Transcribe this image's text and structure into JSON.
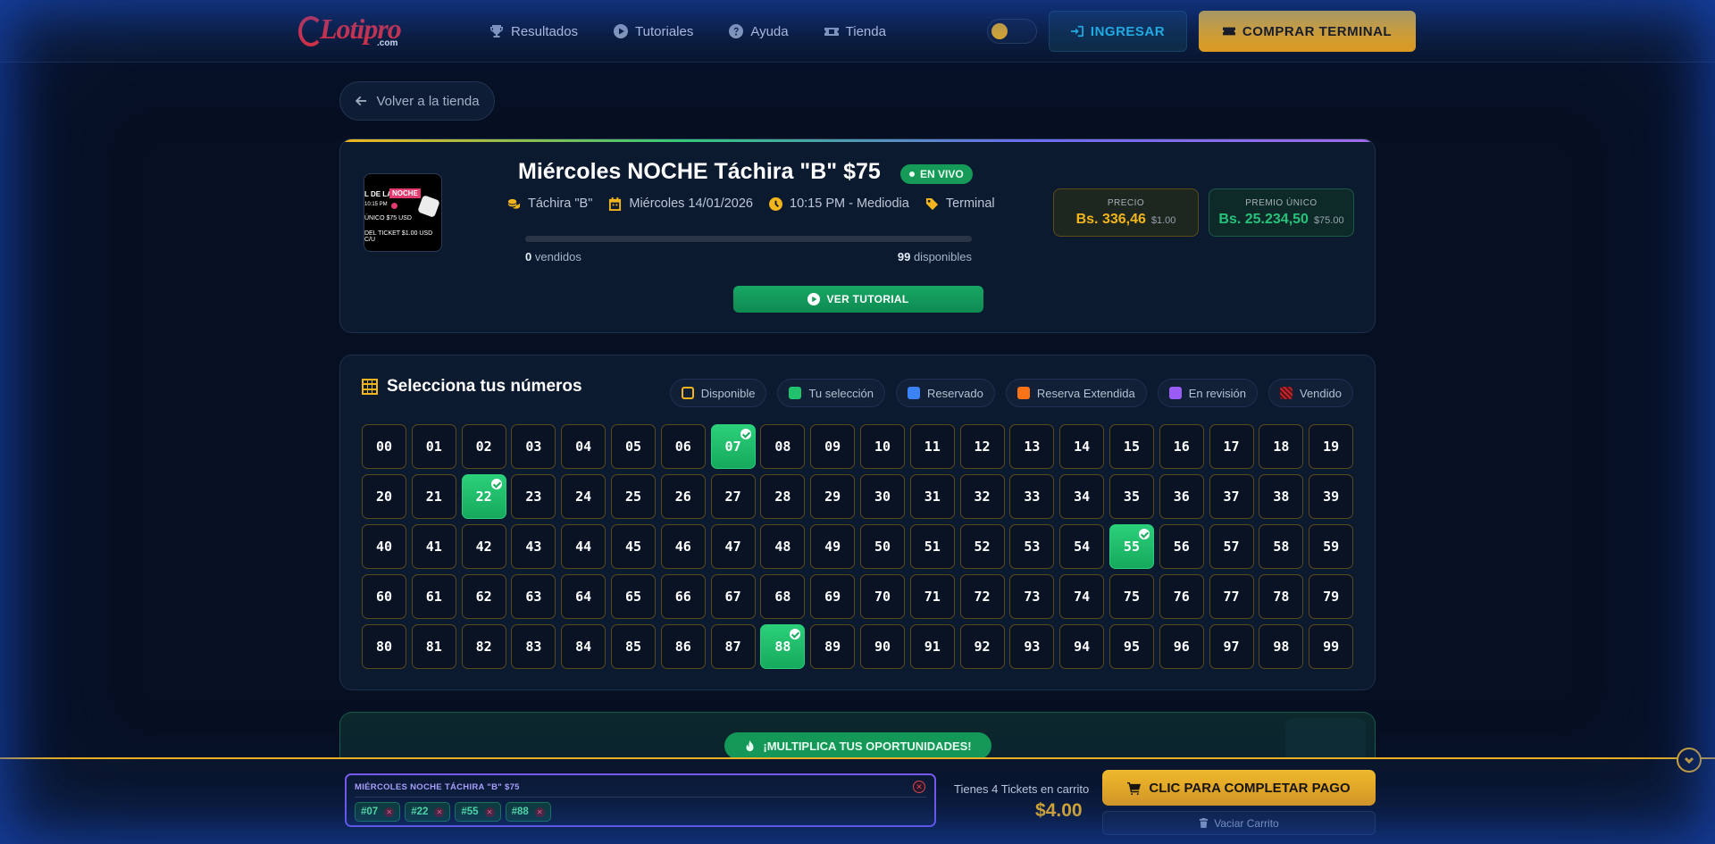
{
  "header": {
    "logo_text": "Lotipro",
    "logo_sub": ".com",
    "nav": [
      {
        "label": "Resultados",
        "icon": "trophy-icon"
      },
      {
        "label": "Tutoriales",
        "icon": "play-circle-icon"
      },
      {
        "label": "Ayuda",
        "icon": "help-circle-icon"
      },
      {
        "label": "Tienda",
        "icon": "ticket-icon"
      }
    ],
    "login_label": "INGRESAR",
    "buy_terminal_label": "COMPRAR TERMINAL"
  },
  "back_label": "Volver a la tienda",
  "event": {
    "title": "Miércoles NOCHE Táchira \"B\" $75",
    "live_label": "EN VIVO",
    "thumb": {
      "line1": "L DE LA",
      "line1b": "NOCHE",
      "line2": "10:15 PM",
      "line3": "ÚNICO  $75 USD",
      "line4": "DEL TICKET  $1.00 USD C/U"
    },
    "meta": [
      {
        "icon": "coins-icon",
        "text": "Táchira \"B\""
      },
      {
        "icon": "calendar-icon",
        "text": "Miércoles 14/01/2026"
      },
      {
        "icon": "clock-icon",
        "text": "10:15 PM - Mediodia"
      },
      {
        "icon": "tag-icon",
        "text": "Terminal"
      }
    ],
    "sold_count": "0",
    "sold_label": " vendidos",
    "available_count": "99",
    "available_label": " disponibles",
    "progress_fraction": 0,
    "tutorial_label": "VER TUTORIAL",
    "price": {
      "label": "PRECIO",
      "main": "Bs. 336,46",
      "sub": "$1.00"
    },
    "prize": {
      "label": "PREMIO ÚNICO",
      "main": "Bs. 25.234,50",
      "sub": "$75.00"
    }
  },
  "grid": {
    "title": "Selecciona tus números",
    "legend": [
      {
        "label": "Disponible",
        "swatch": "disp"
      },
      {
        "label": "Tu selección",
        "swatch": "sel"
      },
      {
        "label": "Reservado",
        "swatch": "res"
      },
      {
        "label": "Reserva Extendida",
        "swatch": "ext"
      },
      {
        "label": "En revisión",
        "swatch": "rev"
      },
      {
        "label": "Vendido",
        "swatch": "vend"
      }
    ],
    "numbers": [
      "00",
      "01",
      "02",
      "03",
      "04",
      "05",
      "06",
      "07",
      "08",
      "09",
      "10",
      "11",
      "12",
      "13",
      "14",
      "15",
      "16",
      "17",
      "18",
      "19",
      "20",
      "21",
      "22",
      "23",
      "24",
      "25",
      "26",
      "27",
      "28",
      "29",
      "30",
      "31",
      "32",
      "33",
      "34",
      "35",
      "36",
      "37",
      "38",
      "39",
      "40",
      "41",
      "42",
      "43",
      "44",
      "45",
      "46",
      "47",
      "48",
      "49",
      "50",
      "51",
      "52",
      "53",
      "54",
      "55",
      "56",
      "57",
      "58",
      "59",
      "60",
      "61",
      "62",
      "63",
      "64",
      "65",
      "66",
      "67",
      "68",
      "69",
      "70",
      "71",
      "72",
      "73",
      "74",
      "75",
      "76",
      "77",
      "78",
      "79",
      "80",
      "81",
      "82",
      "83",
      "84",
      "85",
      "86",
      "87",
      "88",
      "89",
      "90",
      "91",
      "92",
      "93",
      "94",
      "95",
      "96",
      "97",
      "98",
      "99"
    ],
    "selected": [
      "07",
      "22",
      "55",
      "88"
    ]
  },
  "multiplica_label": "¡MULTIPLICA TUS OPORTUNIDADES!",
  "cart": {
    "event_label": "MIÉRCOLES NOCHE TÁCHIRA \"B\" $75",
    "chips": [
      "#07",
      "#22",
      "#55",
      "#88"
    ],
    "count_text": "Tienes 4 Tickets en carrito",
    "total": "$4.00",
    "pay_label": "CLIC PARA COMPLETAR PAGO",
    "empty_label": "Vaciar Carrito"
  },
  "colors": {
    "accent_gold": "#f2b51d",
    "accent_green": "#22c16e",
    "accent_cyan": "#27c2e8",
    "accent_purple": "#7c5cf0"
  }
}
